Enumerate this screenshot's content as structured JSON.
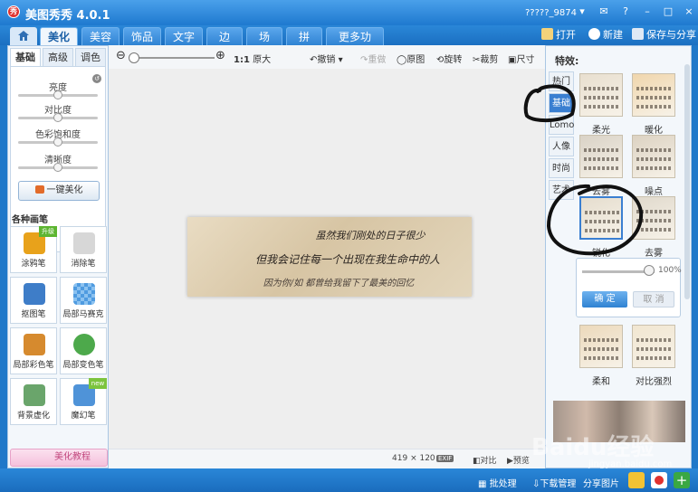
{
  "titlebar": {
    "title": "美图秀秀 4.0.1",
    "account": "?????_9874",
    "logo_glyph": "秀",
    "controls": [
      "▾",
      "✉",
      "?",
      "–",
      "□",
      "×"
    ]
  },
  "nav": {
    "tabs": [
      "美化",
      "美容",
      "饰品",
      "文字",
      "边框",
      "场景",
      "拼图",
      "更多功能"
    ],
    "active_tab": "美化",
    "more_arrow": "▾",
    "open": "打开",
    "new": "新建",
    "save_share": "保存与分享"
  },
  "left_panel": {
    "sub_tabs": [
      "基础",
      "高级",
      "调色"
    ],
    "active_sub_tab": "基础",
    "sliders": [
      {
        "label": "亮度",
        "value": 0.5
      },
      {
        "label": "对比度",
        "value": 0.5
      },
      {
        "label": "色彩饱和度",
        "value": 0.5
      },
      {
        "label": "清晰度",
        "value": 0.5
      }
    ],
    "one_click_beautify": "一键美化",
    "brush_section_title": "各种画笔",
    "tools": [
      {
        "label": "涂鸦笔",
        "badge": "升级",
        "color": "#e8a21b"
      },
      {
        "label": "消除笔",
        "badge": "",
        "color": "#c9c9c9"
      },
      {
        "label": "抠图笔",
        "badge": "",
        "color": "#3e7dc8"
      },
      {
        "label": "局部马赛克",
        "badge": "",
        "color": "#4f9be0"
      },
      {
        "label": "局部彩色笔",
        "badge": "",
        "color": "#d68a2e"
      },
      {
        "label": "局部变色笔",
        "badge": "",
        "color": "#4da94b"
      },
      {
        "label": "背景虚化",
        "badge": "",
        "color": "#6aa56b"
      },
      {
        "label": "魔幻笔",
        "badge": "new",
        "color": "#4f93d8"
      }
    ],
    "tutorial": "美化教程"
  },
  "toolbar": {
    "zoom_ratio": "1:1",
    "original_size": "原大",
    "undo": "撤销",
    "redo": "重做",
    "original": "原图",
    "rotate": "旋转",
    "crop": "裁剪",
    "resize": "尺寸",
    "zoom_level": 0.0
  },
  "canvas": {
    "photo_lines": [
      "虽然我们刚处的日子很少",
      "但我会记住每一个出现在我生命中的人",
      "因为你/如 都曾给我留下了最美的回忆"
    ],
    "width": "419",
    "times": "×",
    "height": "120",
    "exif": "EXIF",
    "compare": "对比",
    "preview": "预览"
  },
  "right_panel": {
    "title": "特效:",
    "vertical_tabs": [
      "热门",
      "基础",
      "Lomo",
      "人像",
      "时尚",
      "艺术"
    ],
    "active_vertical_tab": "基础",
    "effects": [
      {
        "label": "柔光",
        "tint": "#e8dfcf"
      },
      {
        "label": "暖化",
        "tint": "#f0d6ac"
      },
      {
        "label": "去雾",
        "tint": "#d9d2c6"
      },
      {
        "label": "噪点",
        "tint": "#dcd2c2"
      },
      {
        "label": "锐化",
        "tint": "#e5ddce"
      },
      {
        "label": "去雾",
        "tint": "#e0d9cc"
      },
      {
        "label": "柔和",
        "tint": "#ecd9bb"
      },
      {
        "label": "对比强烈",
        "tint": "#f1e6d1"
      }
    ],
    "strength_value": "100%",
    "strength_level": 1.0,
    "confirm": "确 定",
    "cancel": "取 消"
  },
  "bottombar": {
    "batch": "批处理",
    "download": "下载管理",
    "share": "分享图片"
  },
  "watermark": {
    "logo": "Baidu经验",
    "url": "jingyan.baidu.com"
  },
  "colors": {
    "chrome_blue": "#1e79cf",
    "accent": "#3a7fd1"
  }
}
